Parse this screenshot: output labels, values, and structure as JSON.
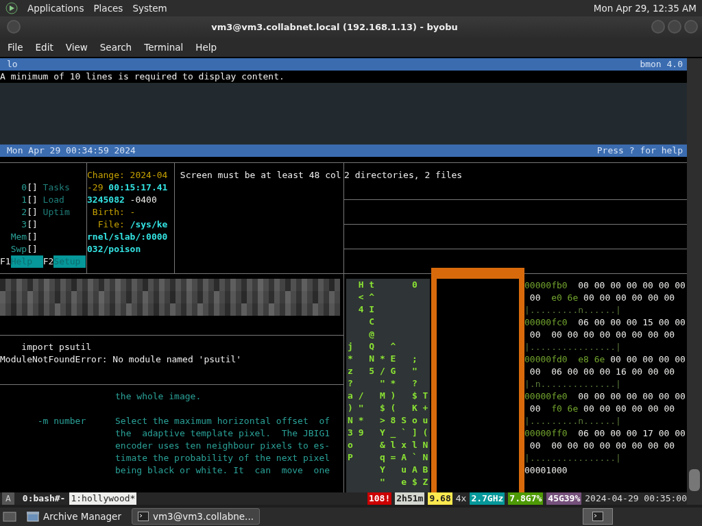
{
  "top_panel": {
    "menus": [
      "Applications",
      "Places",
      "System"
    ],
    "clock": "Mon Apr 29, 12:35 AM"
  },
  "window": {
    "title": "vm3@vm3.collabnet.local (192.168.1.13) - byobu"
  },
  "menu_bar": [
    "File",
    "Edit",
    "View",
    "Search",
    "Terminal",
    "Help"
  ],
  "bmon": {
    "interface": "lo",
    "version": "bmon 4.0",
    "message": "A minimum of 10 lines is required to display content.",
    "timestamp": "Mon Apr 29 00:34:59 2024",
    "help_hint": "Press ? for help"
  },
  "htop": {
    "meters": [
      {
        "label": "0",
        "bar": "[]",
        "name": "Tasks"
      },
      {
        "label": "1",
        "bar": "[]",
        "name": "Load"
      },
      {
        "label": "2",
        "bar": "[]",
        "name": "Uptim"
      },
      {
        "label": "3",
        "bar": "[]"
      },
      {
        "label": "Mem",
        "bar": "[]"
      },
      {
        "label": "Swp",
        "bar": "[]"
      }
    ],
    "keys": [
      {
        "key": "F1",
        "action": "Help"
      },
      {
        "key": "F2",
        "action": "Setup"
      }
    ]
  },
  "stat": [
    [
      {
        "text": "Change: 2024-04",
        "kind": "khaki"
      }
    ],
    [
      {
        "text": "-29 ",
        "kind": "khaki"
      },
      {
        "text": "00:15:17.41",
        "kind": "teal"
      }
    ],
    [
      {
        "text": "3245082",
        "kind": "teal"
      },
      {
        "text": " -0400",
        "kind": "white"
      }
    ],
    [
      {
        "text": " Birth: -",
        "kind": "khaki"
      }
    ],
    [
      {
        "text": "  File: ",
        "kind": "khaki"
      },
      {
        "text": "/sys/ke",
        "kind": "teal"
      }
    ],
    [
      {
        "text": "rnel/slab/:0000",
        "kind": "teal"
      }
    ],
    [
      {
        "text": "032/poison",
        "kind": "teal"
      }
    ]
  ],
  "screen_warning": "Screen must be at least 48 col",
  "tree_summary": "2 directories, 2 files",
  "python": [
    "    import psutil",
    "ModuleNotFoundError: No module named 'psutil'"
  ],
  "man_page": [
    {
      "lines": [
        "the whole image."
      ]
    },
    {
      "term": "-m number",
      "lines": [
        "Select the maximum horizontal offset  of",
        "the  adaptive template pixel.  The JBIG1",
        "encoder uses ten neighbour pixels to es-",
        "timate the probability of the next pixel",
        "being black or white. It  can  move  one"
      ]
    }
  ],
  "matrix": [
    "  H t       0",
    "  < ^",
    "  4 I",
    "    C",
    "    @",
    "j   Q   ^",
    "*   N * E   ;",
    "z   5 / G   \"",
    "?     \" *   ?",
    "a /   M )   $ T",
    ") \"   $ (   K +",
    "N *   > 8 S o u",
    "3 9   Y _ ` ] (",
    "o     & l x l N",
    "P     q = A ` N",
    "      Y   u A B",
    "      \"   e $ Z"
  ],
  "hexdump": [
    [
      {
        "text": "00000fb0",
        "kind": "green"
      },
      {
        "text": "  00 00 00 00 00 00 00",
        "kind": "white"
      }
    ],
    [
      {
        "text": " 00  ",
        "kind": "white"
      },
      {
        "text": "e0 6e",
        "kind": "green"
      },
      {
        "text": " 00 00 00 00 00 00",
        "kind": "white"
      }
    ],
    [
      {
        "text": "|.........n......|",
        "kind": "dim"
      }
    ],
    [
      {
        "text": "00000fc0",
        "kind": "green"
      },
      {
        "text": "  06 00 00 00 15 00 00",
        "kind": "white"
      }
    ],
    [
      {
        "text": " 00  00 00 00 00 00 00 00 00",
        "kind": "white"
      }
    ],
    [
      {
        "text": "|................|",
        "kind": "dim"
      }
    ],
    [
      {
        "text": "00000fd0",
        "kind": "green"
      },
      {
        "text": "  e8 6e",
        "kind": "green"
      },
      {
        "text": " 00 00 00 00 00",
        "kind": "white"
      }
    ],
    [
      {
        "text": " 00  06 00 00 00 16 00 00 00",
        "kind": "white"
      }
    ],
    [
      {
        "text": "|.n..............|",
        "kind": "dim"
      }
    ],
    [
      {
        "text": "00000fe0",
        "kind": "green"
      },
      {
        "text": "  00 00 00 00 00 00 00",
        "kind": "white"
      }
    ],
    [
      {
        "text": " 00  ",
        "kind": "white"
      },
      {
        "text": "f0 6e",
        "kind": "green"
      },
      {
        "text": " 00 00 00 00 00 00",
        "kind": "white"
      }
    ],
    [
      {
        "text": "|.........n......|",
        "kind": "dim"
      }
    ],
    [
      {
        "text": "00000ff0",
        "kind": "green"
      },
      {
        "text": "  06 00 00 00 17 00 00",
        "kind": "white"
      }
    ],
    [
      {
        "text": " 00  00 00 00 00 00 00 00 00",
        "kind": "white"
      }
    ],
    [
      {
        "text": "|................|",
        "kind": "dim"
      }
    ],
    [
      {
        "text": "00001000",
        "kind": "white"
      }
    ]
  ],
  "status_bar": {
    "session": "A",
    "windows": [
      {
        "label": "0:bash#-",
        "selected": false
      },
      {
        "label": "1:hollywood*",
        "selected": true
      }
    ],
    "widgets": [
      {
        "kind": "badge",
        "text": "108!",
        "color": "#cc0000"
      },
      {
        "kind": "badge",
        "text": "2h51m",
        "color": "#d3d7cf"
      },
      {
        "kind": "badge",
        "text": "9.68",
        "color": "#fce94f"
      },
      {
        "kind": "plain",
        "text": "4x"
      },
      {
        "kind": "badge",
        "text": "2.7GHz",
        "color": "#06989a"
      },
      {
        "kind": "badge",
        "text": "7.8G7%",
        "color": "#4e9a06"
      },
      {
        "kind": "badge",
        "text": "45G39%",
        "color": "#75507b"
      },
      {
        "kind": "plain",
        "text": "2024-04-29 00:35:00"
      }
    ]
  },
  "taskbar": [
    {
      "label": "Archive Manager",
      "selected": false,
      "kind": "archive"
    },
    {
      "label": "vm3@vm3.collabne...",
      "selected": true,
      "kind": "terminal"
    }
  ]
}
